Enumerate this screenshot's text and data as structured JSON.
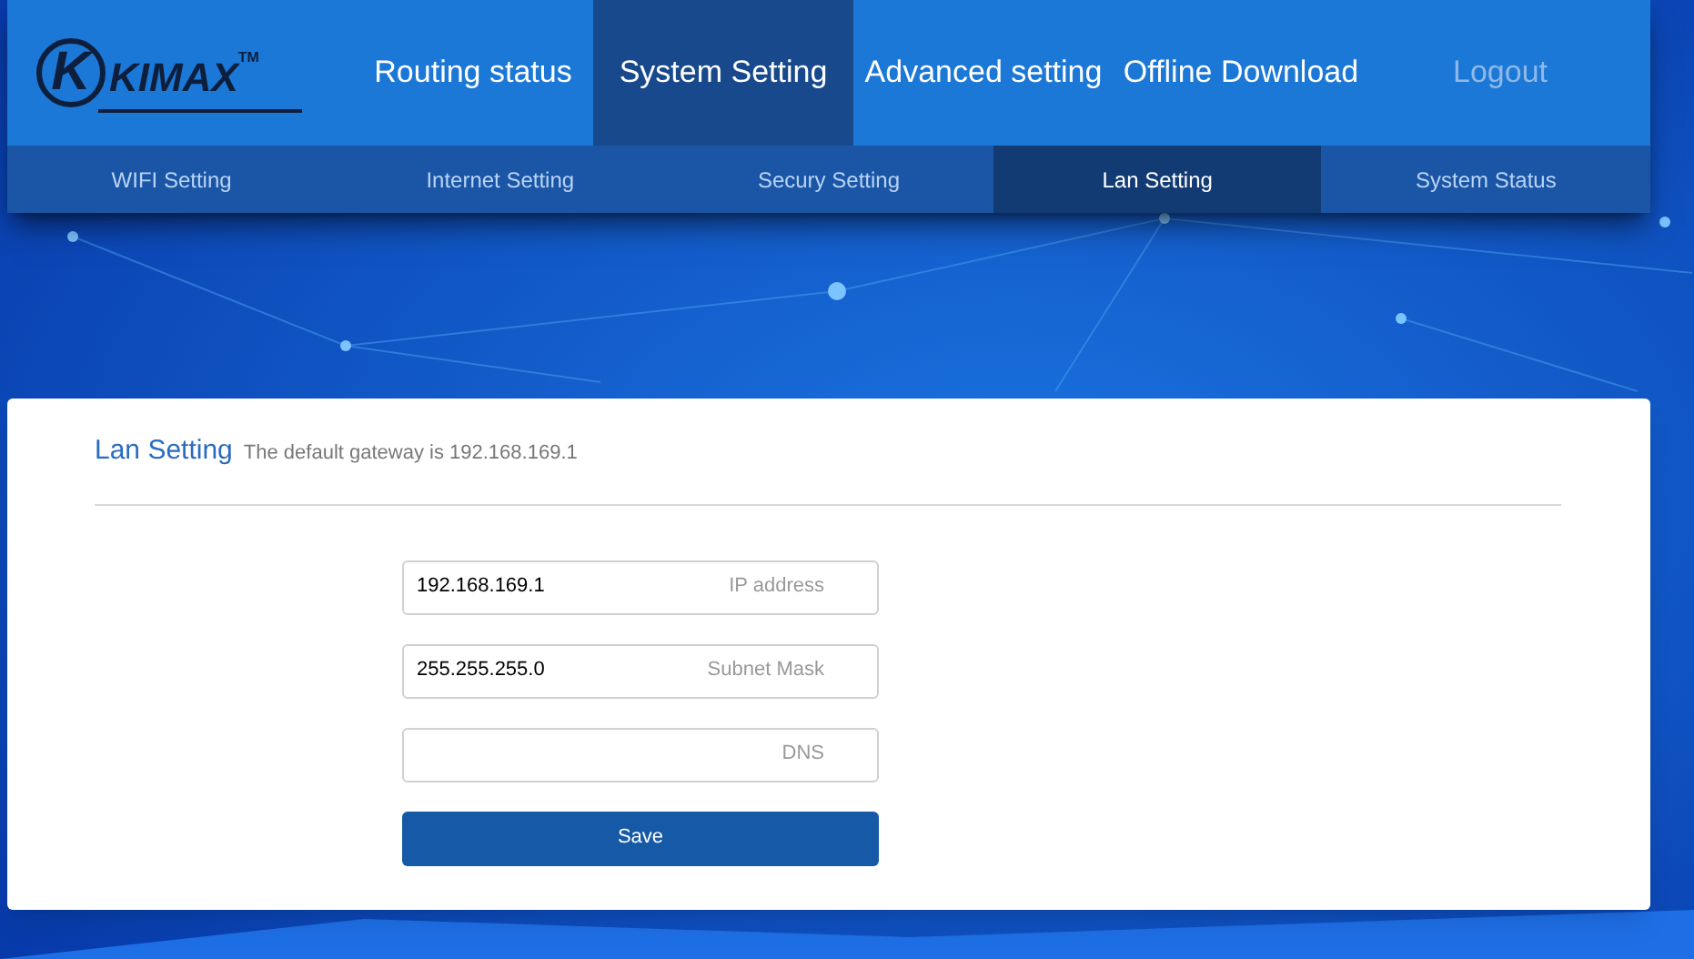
{
  "logo": {
    "mark": "K",
    "name": "KIMAX",
    "tm": "TM"
  },
  "nav": [
    {
      "label": "Routing status",
      "selected": false
    },
    {
      "label": "System Setting",
      "selected": true
    },
    {
      "label": "Advanced setting",
      "selected": false
    },
    {
      "label": "Offline Download",
      "selected": false
    }
  ],
  "logout": "Logout",
  "subnav": [
    {
      "label": "WIFI Setting",
      "selected": false
    },
    {
      "label": "Internet Setting",
      "selected": false
    },
    {
      "label": "Secury Setting",
      "selected": false
    },
    {
      "label": "Lan Setting",
      "selected": true
    },
    {
      "label": "System Status",
      "selected": false
    }
  ],
  "panel": {
    "title": "Lan Setting",
    "subtitle": "The default gateway is 192.168.169.1",
    "fields": [
      {
        "value": "192.168.169.1",
        "label": "IP address"
      },
      {
        "value": "255.255.255.0",
        "label": "Subnet Mask"
      },
      {
        "label": "DNS"
      }
    ],
    "button": "Save"
  }
}
